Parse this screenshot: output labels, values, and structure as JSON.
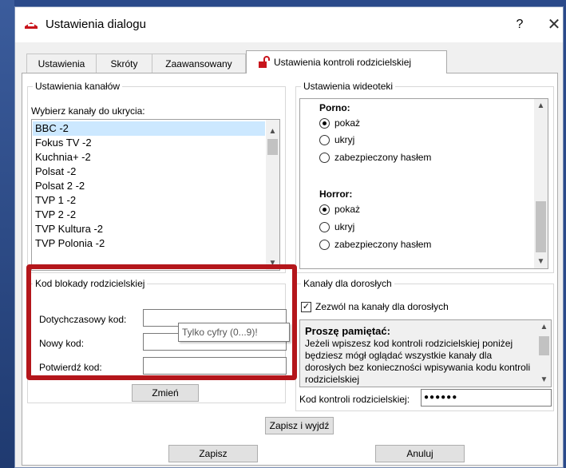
{
  "window": {
    "title": "Ustawienia dialogu",
    "help_glyph": "?",
    "close_glyph": "✕"
  },
  "tabs": [
    {
      "label": "Ustawienia"
    },
    {
      "label": "Skróty"
    },
    {
      "label": "Zaawansowany"
    },
    {
      "label": "Ustawienia kontroli rodzicielskiej"
    }
  ],
  "channels_group": {
    "title": "Ustawienia kanałów",
    "prompt": "Wybierz kanały do ukrycia:",
    "items": [
      "BBC -2",
      "Fokus TV -2",
      "Kuchnia+ -2",
      "Polsat -2",
      "Polsat 2 -2",
      "TVP 1 -2",
      "TVP 2 -2",
      "TVP Kultura -2",
      "TVP Polonia -2"
    ]
  },
  "video_group": {
    "title": "Ustawienia wideoteki",
    "categories": [
      {
        "name": "Porno:",
        "options": [
          "pokaż",
          "ukryj",
          "zabezpieczony hasłem"
        ],
        "selected": 0
      },
      {
        "name": "Horror:",
        "options": [
          "pokaż",
          "ukryj",
          "zabezpieczony hasłem"
        ],
        "selected": 0
      }
    ]
  },
  "lock_group": {
    "title": "Kod blokady rodzicielskiej",
    "current_label": "Dotychczasowy kod:",
    "new_label": "Nowy kod:",
    "confirm_label": "Potwierdź kod:",
    "change_button": "Zmień",
    "tooltip": "Tylko cyfry (0...9)!"
  },
  "adult_group": {
    "title": "Kanały dla dorosłych",
    "checkbox_label": "Zezwól na kanały dla dorosłych",
    "checked": true,
    "note_title": "Proszę pamiętać:",
    "note_text": "Jeżeli wpiszesz kod kontroli rodzicielskiej poniżej będziesz mógł oglądać wszystkie kanały dla dorosłych bez konieczności wpisywania kodu kontroli rodzicielskiej",
    "code_label": "Kod kontroli rodzicielskiej:",
    "code_value": "●●●●●●"
  },
  "buttons": {
    "save_exit": "Zapisz i wyjdź",
    "save": "Zapisz",
    "cancel": "Anuluj"
  },
  "colors": {
    "highlight": "#b4161b",
    "selection": "#cce8ff",
    "lock_icon": "#c8141c"
  },
  "icons": {
    "app": "app-icon",
    "lock": "unlock-icon",
    "check": "check-icon"
  }
}
